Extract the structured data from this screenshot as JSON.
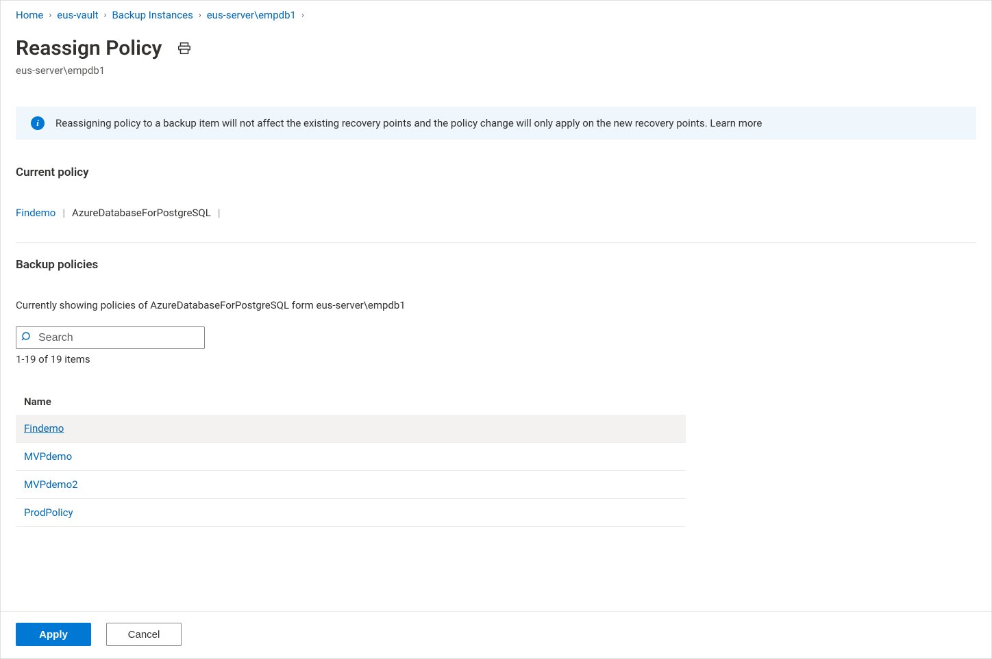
{
  "breadcrumb": [
    {
      "label": "Home"
    },
    {
      "label": "eus-vault"
    },
    {
      "label": "Backup Instances"
    },
    {
      "label": "eus-server\\empdb1"
    }
  ],
  "page": {
    "title": "Reassign Policy",
    "subtitle": "eus-server\\empdb1"
  },
  "info": {
    "text": "Reassigning policy to a backup item will not affect the existing recovery points and the policy change will only apply on the new recovery points. Learn more"
  },
  "current_policy": {
    "label": "Current policy",
    "name": "Findemo",
    "type": "AzureDatabaseForPostgreSQL"
  },
  "backup_policies": {
    "label": "Backup policies",
    "showing": "Currently showing policies of AzureDatabaseForPostgreSQL form eus-server\\empdb1",
    "search_placeholder": "Search",
    "count": "1-19 of 19 items",
    "column_name": "Name",
    "rows": [
      {
        "name": "Findemo",
        "selected": true
      },
      {
        "name": "MVPdemo",
        "selected": false
      },
      {
        "name": "MVPdemo2",
        "selected": false
      },
      {
        "name": "ProdPolicy",
        "selected": false
      }
    ]
  },
  "footer": {
    "apply": "Apply",
    "cancel": "Cancel"
  }
}
